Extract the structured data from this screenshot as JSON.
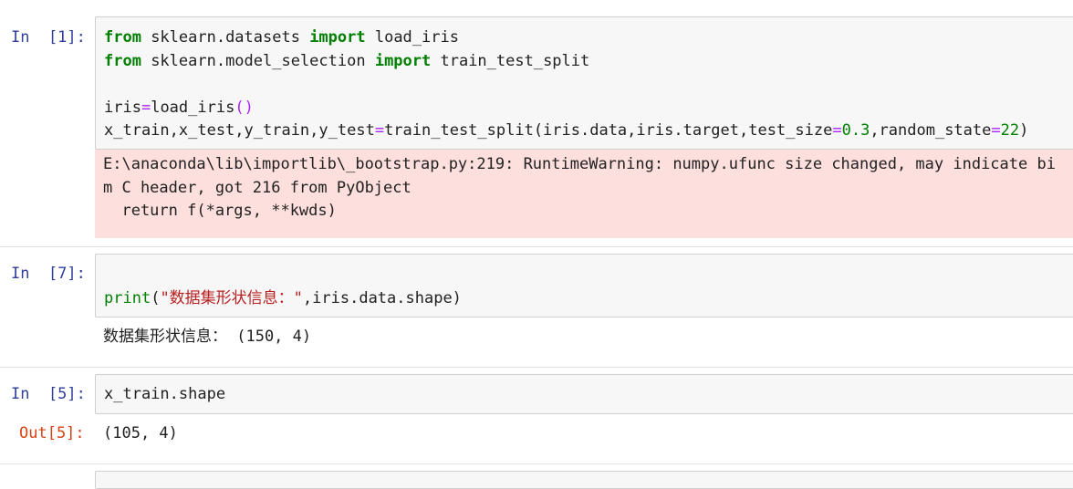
{
  "cells": [
    {
      "prompt": "In  [1]:",
      "code_lines": [
        [
          {
            "t": "from",
            "c": "kw"
          },
          {
            "t": " sklearn.datasets ",
            "c": ""
          },
          {
            "t": "import",
            "c": "kw"
          },
          {
            "t": " load_iris",
            "c": ""
          }
        ],
        [
          {
            "t": "from",
            "c": "kw"
          },
          {
            "t": " sklearn.model_selection ",
            "c": ""
          },
          {
            "t": "import",
            "c": "kw"
          },
          {
            "t": " train_test_split",
            "c": ""
          }
        ],
        [],
        [
          {
            "t": "iris",
            "c": ""
          },
          {
            "t": "=",
            "c": "op"
          },
          {
            "t": "load_iris",
            "c": ""
          },
          {
            "t": "()",
            "c": "op"
          }
        ],
        [
          {
            "t": "x_train,x_test,y_train,y_test",
            "c": ""
          },
          {
            "t": "=",
            "c": "op"
          },
          {
            "t": "train_test_split(iris.data,iris.target,test_size",
            "c": ""
          },
          {
            "t": "=",
            "c": "op"
          },
          {
            "t": "0.3",
            "c": "num"
          },
          {
            "t": ",random_state",
            "c": ""
          },
          {
            "t": "=",
            "c": "op"
          },
          {
            "t": "22",
            "c": "num"
          },
          {
            "t": ")",
            "c": ""
          }
        ]
      ],
      "stderr_lines": [
        "E:\\anaconda\\lib\\importlib\\_bootstrap.py:219: RuntimeWarning: numpy.ufunc size changed, may indicate bi",
        "m C header, got 216 from PyObject",
        "  return f(*args, **kwds)"
      ]
    },
    {
      "prompt": "In  [7]:",
      "code_lines": [
        [],
        [
          {
            "t": "print",
            "c": "bi"
          },
          {
            "t": "(",
            "c": ""
          },
          {
            "t": "\"数据集形状信息：\"",
            "c": "str"
          },
          {
            "t": ",iris.data.shape)",
            "c": ""
          }
        ]
      ],
      "output": "数据集形状信息： (150, 4)"
    },
    {
      "prompt": "In  [5]:",
      "code_lines": [
        [
          {
            "t": "x_train.shape",
            "c": ""
          }
        ]
      ],
      "out_prompt": "Out[5]:",
      "output": "(105, 4)"
    }
  ]
}
